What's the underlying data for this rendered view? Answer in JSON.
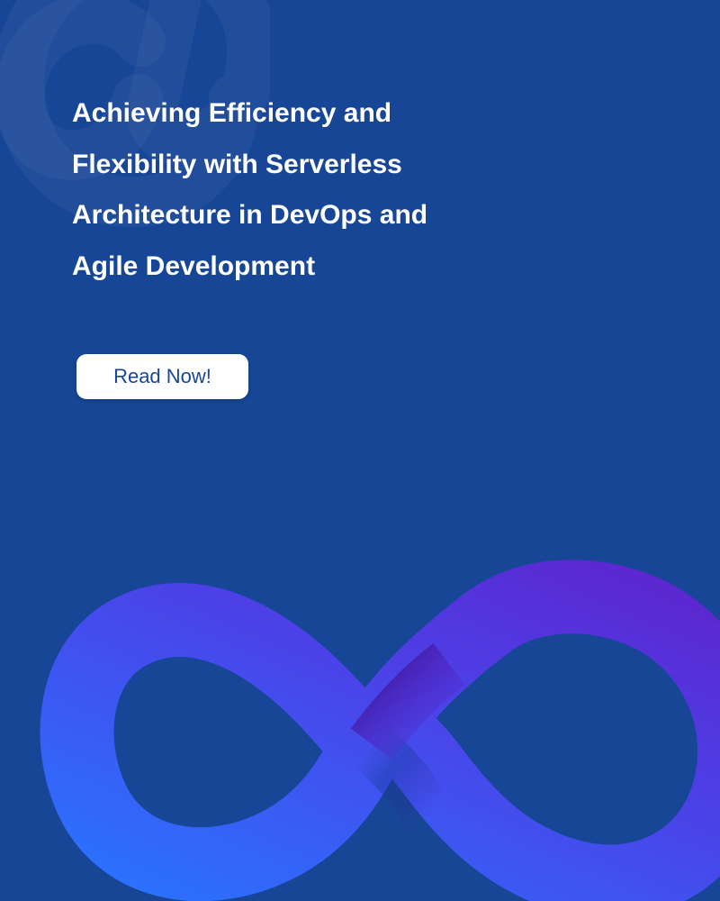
{
  "headline": {
    "lines": [
      "Achieving Efficiency and",
      "Flexibility with Serverless",
      "Architecture in DevOps and",
      "Agile Development"
    ]
  },
  "cta": {
    "label": "Read Now!"
  },
  "colors": {
    "background": "#174696",
    "headline_text": "#ffffff",
    "button_background": "#ffffff",
    "button_text": "#174696",
    "infinity_blue": "#2a73ff",
    "infinity_violet": "#5d25cf",
    "infinity_shadow": "#4b138f"
  },
  "icons": {
    "watermark": "at-symbol-watermark-icon",
    "devops": "infinity-loop-icon"
  }
}
